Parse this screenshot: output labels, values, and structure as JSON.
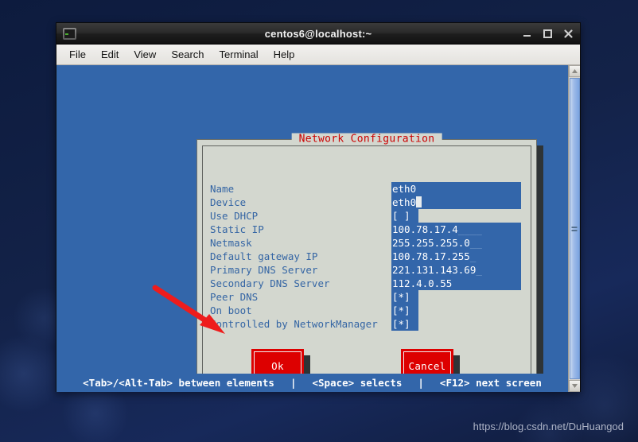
{
  "window": {
    "title": "centos6@localhost:~",
    "icon": "terminal-icon",
    "buttons": {
      "minimize": "minimize-icon",
      "maximize": "maximize-icon",
      "close": "close-icon"
    }
  },
  "menubar": {
    "items": [
      {
        "label": "File"
      },
      {
        "label": "Edit"
      },
      {
        "label": "View"
      },
      {
        "label": "Search"
      },
      {
        "label": "Terminal"
      },
      {
        "label": "Help"
      }
    ]
  },
  "dialog": {
    "title": "Network Configuration",
    "rows": [
      {
        "label": "Name",
        "value": "eth0",
        "trail": "",
        "type": "text",
        "cursor": false
      },
      {
        "label": "Device",
        "value": "eth0",
        "trail": "",
        "type": "text",
        "cursor": true
      },
      {
        "label": "Use DHCP",
        "value": "[ ]",
        "trail": "",
        "type": "check",
        "cursor": false
      },
      {
        "label": "Static IP",
        "value": "100.78.17.4",
        "trail": "____",
        "type": "text",
        "cursor": false
      },
      {
        "label": "Netmask",
        "value": "255.255.255.0",
        "trail": "__",
        "type": "text",
        "cursor": false
      },
      {
        "label": "Default gateway IP",
        "value": "100.78.17.255",
        "trail": "_",
        "type": "text",
        "cursor": false
      },
      {
        "label": "Primary DNS Server",
        "value": "221.131.143.69",
        "trail": "_",
        "type": "text",
        "cursor": false
      },
      {
        "label": "Secondary DNS Server",
        "value": "112.4.0.55",
        "trail": "",
        "type": "text",
        "cursor": false
      },
      {
        "label": "Peer DNS",
        "value": "[*]",
        "trail": "",
        "type": "check",
        "cursor": false
      },
      {
        "label": "On boot",
        "value": "[*]",
        "trail": "",
        "type": "check",
        "cursor": false
      },
      {
        "label": "Controlled by NetworkManager",
        "value": "[*]",
        "trail": "",
        "type": "check",
        "cursor": false
      }
    ],
    "buttons": {
      "ok": "Ok",
      "cancel": "Cancel"
    }
  },
  "statusbar": {
    "hint1": "<Tab>/<Alt-Tab> between elements",
    "sep1": "|",
    "hint2": "<Space> selects",
    "sep2": "|",
    "hint3": "<F12> next screen"
  },
  "annotation": {
    "arrow": "red-arrow-pointing-to-ok-button"
  },
  "watermark": {
    "text": "https://blog.csdn.net/DuHuangod"
  },
  "colors": {
    "terminal_blue": "#3366aa",
    "dialog_gray": "#d3d7cf",
    "label_blue": "#3465a4",
    "title_red": "#cc0000",
    "annotation_red": "#ee1c1c",
    "shadow": "#2f3436"
  }
}
